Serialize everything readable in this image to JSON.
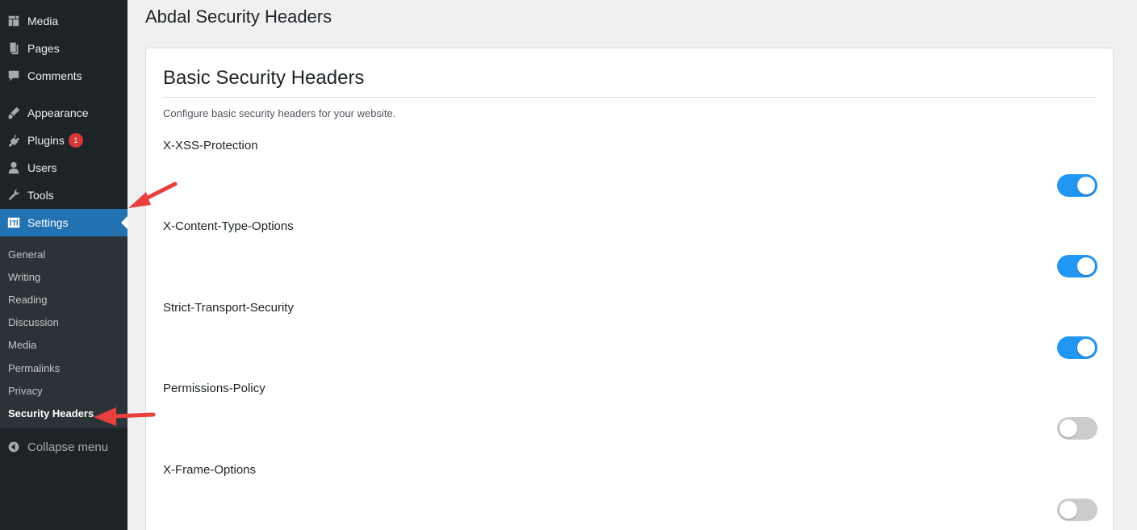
{
  "sidebar": {
    "items": [
      {
        "label": "Media",
        "icon": "media-icon"
      },
      {
        "label": "Pages",
        "icon": "pages-icon"
      },
      {
        "label": "Comments",
        "icon": "comments-icon"
      },
      {
        "label": "Appearance",
        "icon": "appearance-icon"
      },
      {
        "label": "Plugins",
        "icon": "plugins-icon",
        "badge": "1"
      },
      {
        "label": "Users",
        "icon": "users-icon"
      },
      {
        "label": "Tools",
        "icon": "tools-icon"
      },
      {
        "label": "Settings",
        "icon": "settings-icon",
        "active": true
      }
    ],
    "submenu": [
      {
        "label": "General"
      },
      {
        "label": "Writing"
      },
      {
        "label": "Reading"
      },
      {
        "label": "Discussion"
      },
      {
        "label": "Media"
      },
      {
        "label": "Permalinks"
      },
      {
        "label": "Privacy"
      },
      {
        "label": "Security Headers",
        "current": true
      }
    ],
    "collapse_label": "Collapse menu"
  },
  "page": {
    "title": "Abdal Security Headers"
  },
  "card": {
    "title": "Basic Security Headers",
    "description": "Configure basic security headers for your website.",
    "settings": [
      {
        "label": "X-XSS-Protection",
        "enabled": true
      },
      {
        "label": "X-Content-Type-Options",
        "enabled": true
      },
      {
        "label": "Strict-Transport-Security",
        "enabled": true
      },
      {
        "label": "Permissions-Policy",
        "enabled": false
      },
      {
        "label": "X-Frame-Options",
        "enabled": false
      }
    ]
  },
  "colors": {
    "sidebar_bg": "#1d2327",
    "active_blue": "#2271b1",
    "toggle_on": "#2196f3",
    "toggle_off": "#cccccc",
    "badge_red": "#d63638",
    "arrow_red": "#e8403f"
  }
}
